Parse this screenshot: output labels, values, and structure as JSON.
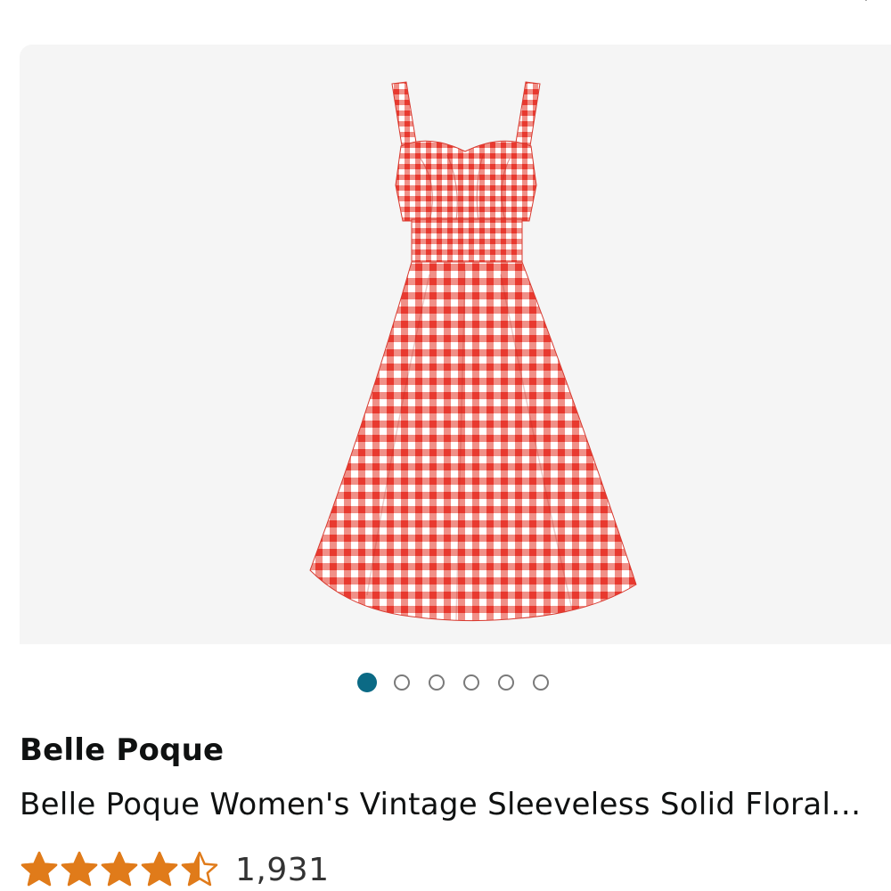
{
  "product": {
    "brand": "Belle Poque",
    "title": "Belle Poque Women's Vintage Sleeveless Solid Floral…",
    "rating": 4.5,
    "rating_max": 5,
    "review_count": "1,931",
    "image_subject": "red and white gingham sleeveless swing dress"
  },
  "carousel": {
    "total_images": 6,
    "active_index": 0
  },
  "icons": {
    "close": "close-icon",
    "star": "star-icon"
  },
  "colors": {
    "star": "#e07b1a",
    "active_dot": "#0b6a85",
    "inactive_dot_border": "#7a7a7a",
    "image_background": "#f5f5f5",
    "gingham_red": "#e8392f"
  }
}
